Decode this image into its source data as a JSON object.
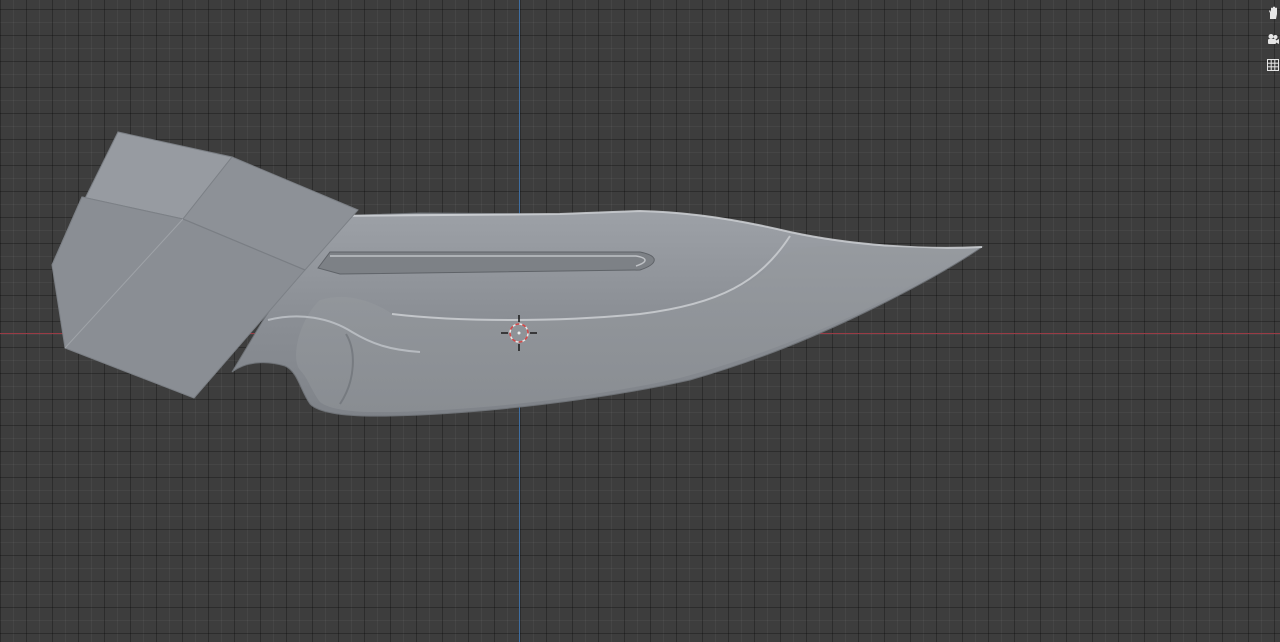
{
  "viewport": {
    "background_color": "#3d3d3d",
    "grid_color": "#2c2c2c",
    "x_axis_color": "#9a3b45",
    "y_axis_color": "#3f6fa3",
    "mesh_color": "#8e9298"
  },
  "scene": {
    "object": "knife-mesh",
    "parts": [
      "handle-block",
      "blade",
      "fuller",
      "blade-bevel"
    ],
    "cursor": "3d-cursor-icon"
  },
  "navigation_gizmo": {
    "buttons": [
      {
        "name": "pan-hand-icon"
      },
      {
        "name": "camera-icon"
      },
      {
        "name": "grid-icon"
      }
    ]
  }
}
